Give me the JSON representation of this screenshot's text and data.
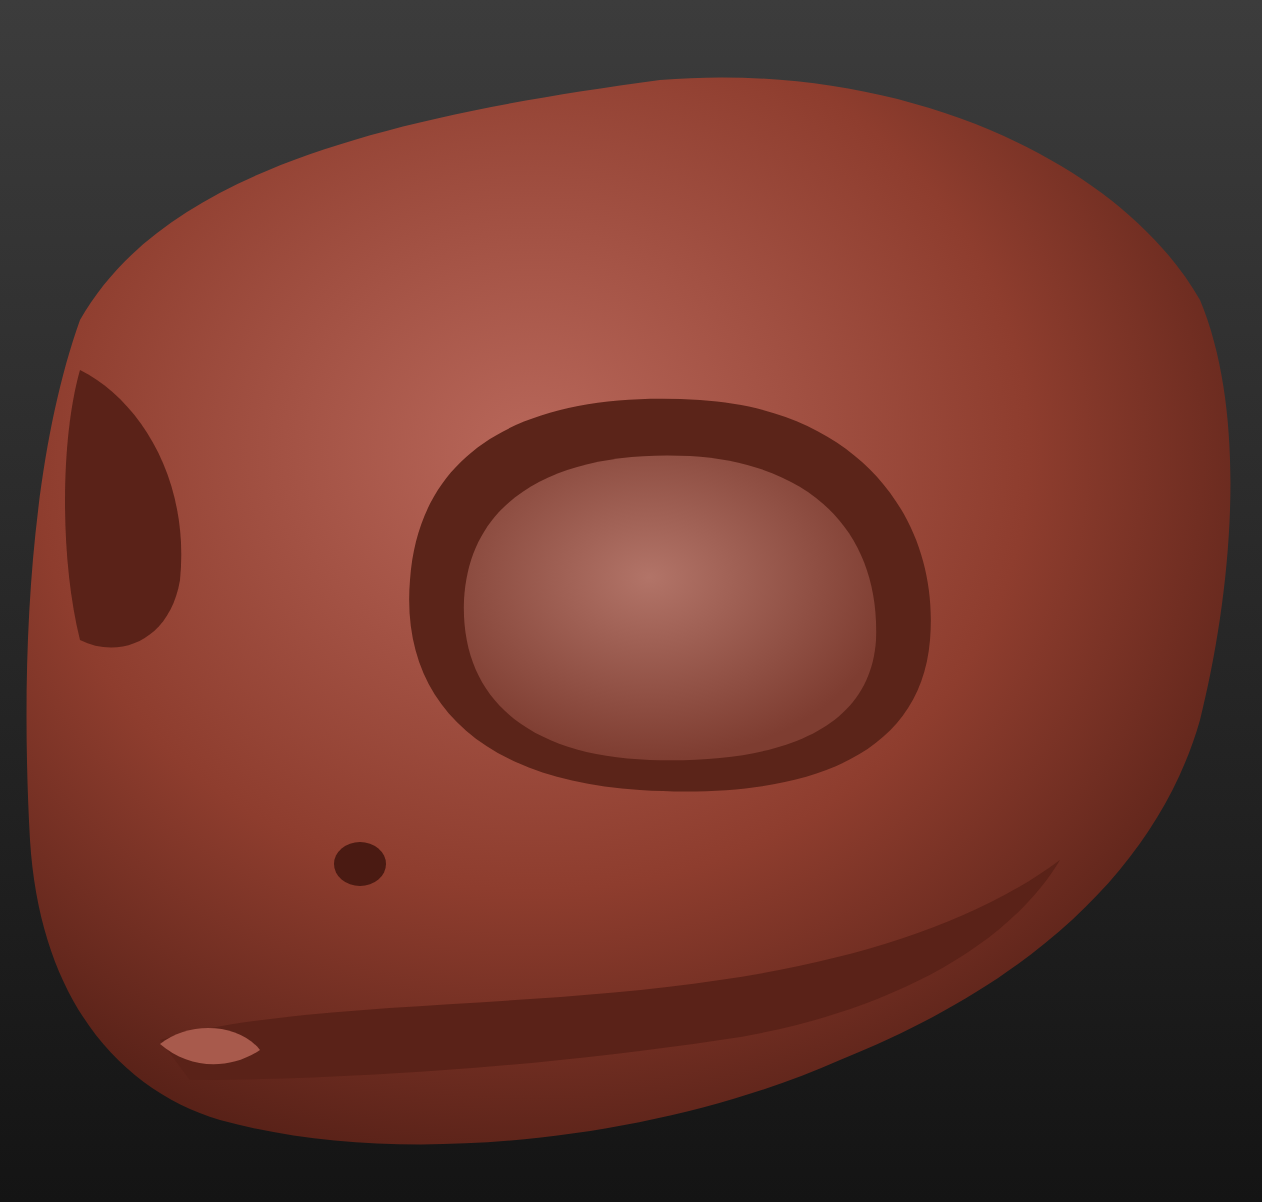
{
  "viewport": {
    "kind": "sculpt"
  }
}
